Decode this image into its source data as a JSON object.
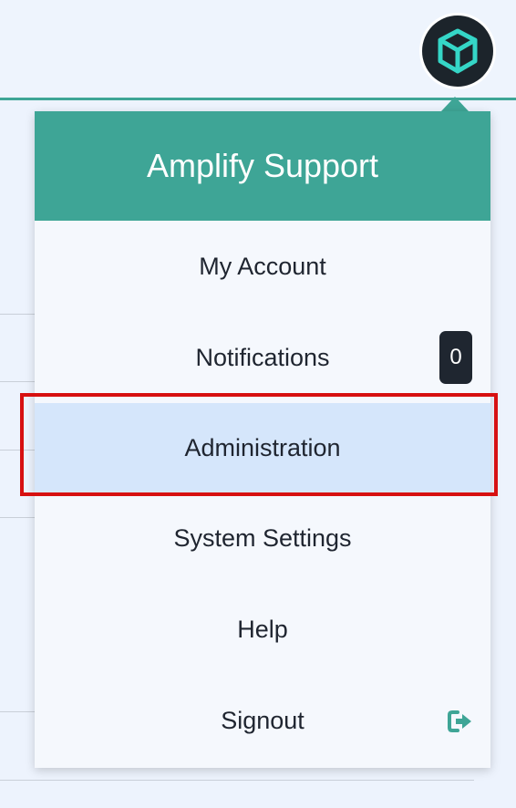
{
  "header": {
    "avatar_icon": "cube-icon",
    "accent_color": "#3ea596"
  },
  "menu": {
    "title": "Amplify Support",
    "items": [
      {
        "label": "My Account"
      },
      {
        "label": "Notifications",
        "badge": "0"
      },
      {
        "label": "Administration",
        "active": true
      },
      {
        "label": "System Settings"
      },
      {
        "label": "Help"
      },
      {
        "label": "Signout",
        "icon": "signout-icon"
      }
    ]
  },
  "highlight": {
    "color": "#d71010"
  }
}
